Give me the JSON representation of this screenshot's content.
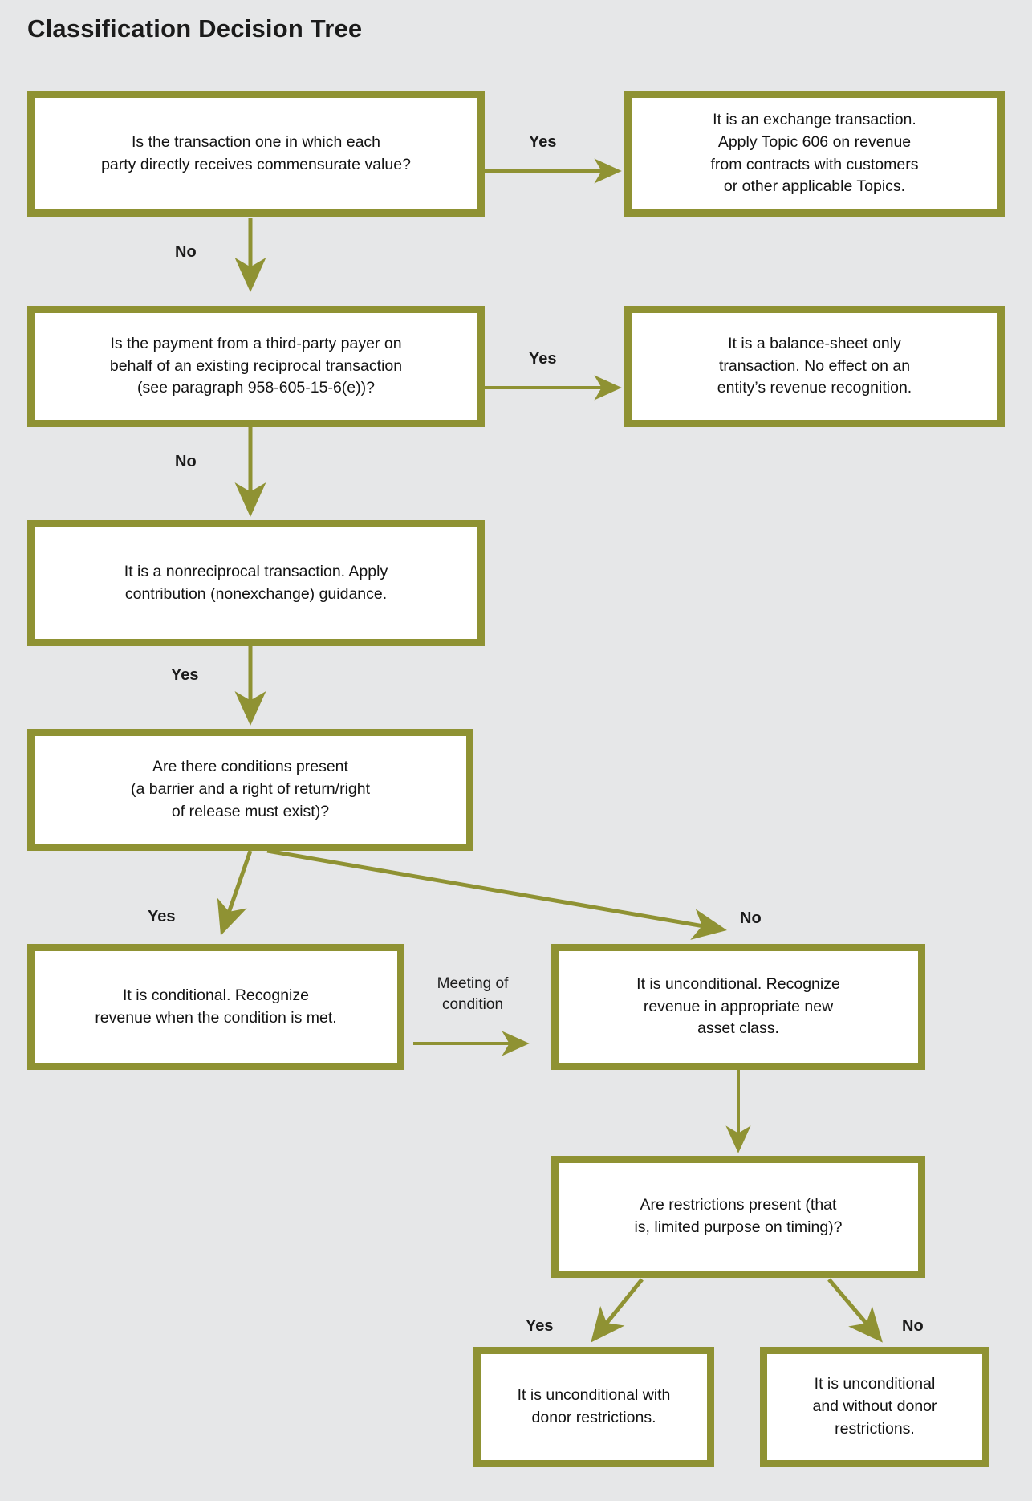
{
  "page": {
    "title": "Classification Decision Tree",
    "background_color": "#e6e7e8",
    "accent_color": "#8f9233",
    "node_fill": "#ffffff",
    "text_color": "#131313"
  },
  "nodes": {
    "q1": "Is the transaction one in which each\nparty directly receives commensurate value?",
    "r1": "It is an exchange transaction.\nApply Topic 606 on revenue\nfrom contracts with customers\nor other applicable Topics.",
    "q2": "Is the payment from a third-party payer on\nbehalf of an existing reciprocal transaction\n(see paragraph 958-605-15-6(e))?",
    "r2": "It is a balance-sheet only\ntransaction. No effect on an\nentity’s revenue recognition.",
    "n3": "It is a nonreciprocal transaction. Apply\ncontribution (nonexchange) guidance.",
    "q4": "Are there conditions present\n(a barrier and a right of return/right\nof release must exist)?",
    "r4_yes": "It is conditional. Recognize\nrevenue when the condition is met.",
    "r4_no": "It is unconditional. Recognize\nrevenue in appropriate new\nasset class.",
    "q5": "Are restrictions present (that\nis, limited purpose on timing)?",
    "r5_yes": "It is unconditional with\ndonor restrictions.",
    "r5_no": "It is unconditional\nand without donor\nrestrictions."
  },
  "edge_labels": {
    "q1_yes": "Yes",
    "q1_no": "No",
    "q2_yes": "Yes",
    "q2_no": "No",
    "n3_yes": "Yes",
    "q4_yes": "Yes",
    "q4_no": "No",
    "meeting_of_condition": "Meeting of\ncondition",
    "q5_yes": "Yes",
    "q5_no": "No"
  }
}
